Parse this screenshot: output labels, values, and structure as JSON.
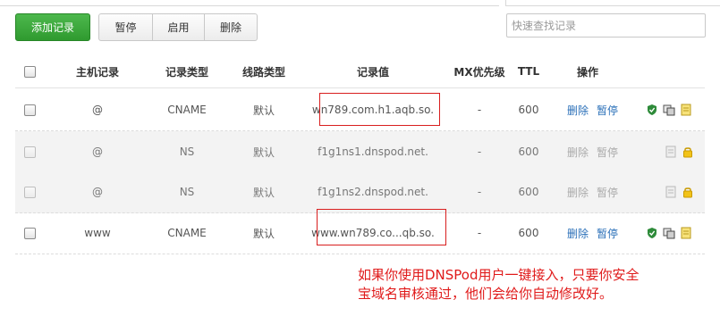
{
  "toolbar": {
    "add_record_label": "添加记录",
    "pause_label": "暂停",
    "enable_label": "启用",
    "delete_label": "删除"
  },
  "search": {
    "placeholder": "快速查找记录"
  },
  "table": {
    "columns": {
      "host": "主机记录",
      "type": "记录类型",
      "line": "线路类型",
      "value": "记录值",
      "mx": "MX优先级",
      "ttl": "TTL",
      "action": "操作"
    },
    "rows": [
      {
        "host": "@",
        "type": "CNAME",
        "line": "默认",
        "value": "wn789.com.h1.aqb.so.",
        "mx": "-",
        "ttl": "600",
        "delete": "删除",
        "pause": "暂停",
        "editable": true
      },
      {
        "host": "@",
        "type": "NS",
        "line": "默认",
        "value": "f1g1ns1.dnspod.net.",
        "mx": "-",
        "ttl": "600",
        "delete": "删除",
        "pause": "暂停",
        "editable": false
      },
      {
        "host": "@",
        "type": "NS",
        "line": "默认",
        "value": "f1g1ns2.dnspod.net.",
        "mx": "-",
        "ttl": "600",
        "delete": "删除",
        "pause": "暂停",
        "editable": false
      },
      {
        "host": "www",
        "type": "CNAME",
        "line": "默认",
        "value": "www.wn789.co...qb.so.",
        "mx": "-",
        "ttl": "600",
        "delete": "删除",
        "pause": "暂停",
        "editable": true
      }
    ]
  },
  "annotation": {
    "line1": "如果你使用DNSPod用户一键接入，只要你安全",
    "line2": "宝域名审核通过，他们会给你自动修改好。"
  },
  "colors": {
    "accent_green": "#2f9a2f",
    "link_blue": "#2a6fb8",
    "annotation_red": "#e01a1a"
  },
  "icons": [
    "shield-icon",
    "copy-icon",
    "note-icon",
    "lock-icon"
  ]
}
